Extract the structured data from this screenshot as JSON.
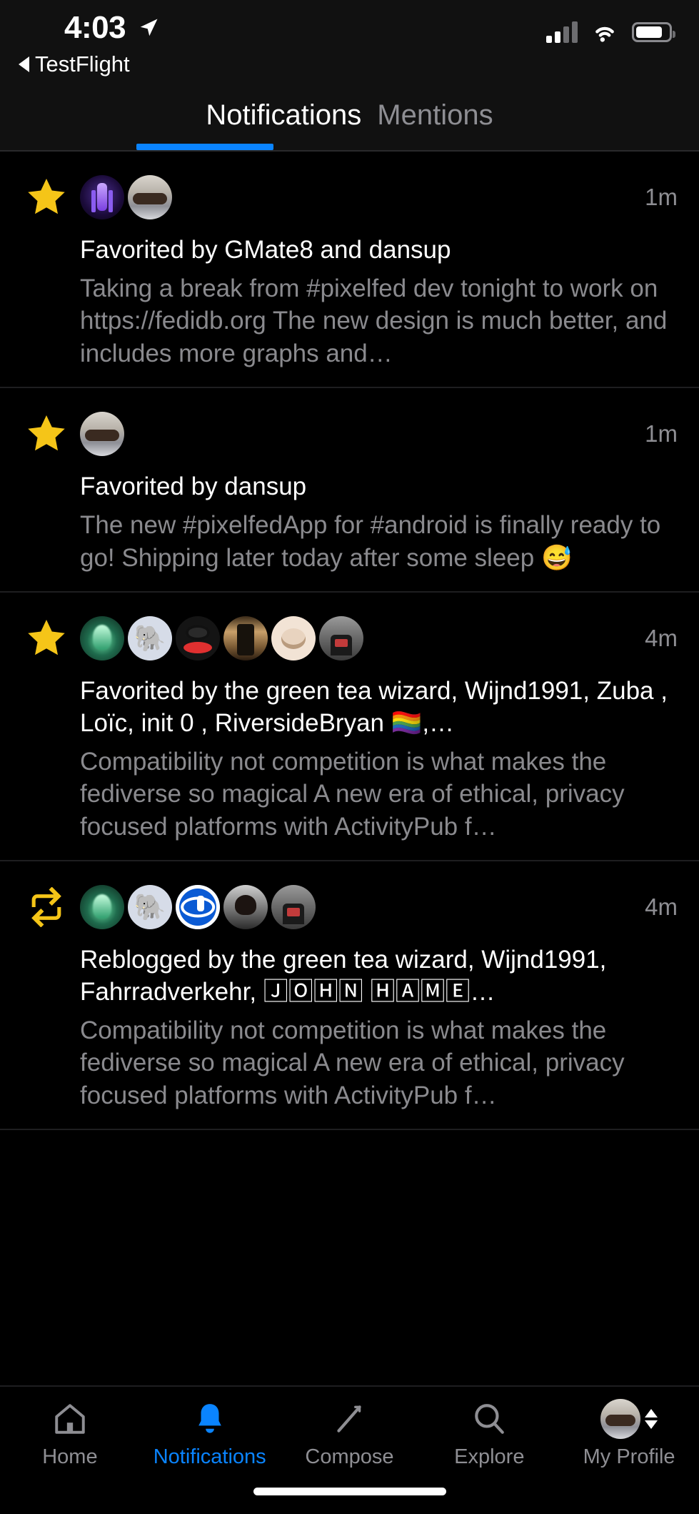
{
  "status_bar": {
    "time": "4:03",
    "back_label": "TestFlight",
    "location_icon": "location-arrow-icon",
    "signal_icon": "cellular-signal-icon",
    "wifi_icon": "wifi-icon",
    "battery_icon": "battery-icon"
  },
  "top_tabs": {
    "items": [
      {
        "label": "Notifications",
        "active": true
      },
      {
        "label": "Mentions",
        "active": false
      }
    ],
    "indicator_color": "#0a84ff"
  },
  "colors": {
    "accent": "#0a84ff",
    "star": "#f5c518",
    "reblog": "#f5c518",
    "title_text": "#ffffff",
    "body_text": "#8a8a8e",
    "timestamp_text": "#8e8e93",
    "background": "#000000",
    "header_background": "#111111",
    "divider": "#1e1e20"
  },
  "notifications": [
    {
      "type_icon": "star-icon",
      "type": "favorite",
      "avatars": [
        "av-gmate8",
        "av-dansup"
      ],
      "title": "Favorited by GMate8 and dansup",
      "body": "Taking a break from #pixelfed dev tonight to work on https://fedidb.org The new design is much better, and includes more graphs and…",
      "timestamp": "1m"
    },
    {
      "type_icon": "star-icon",
      "type": "favorite",
      "avatars": [
        "av-dansup"
      ],
      "title": "Favorited by dansup",
      "body": "The new #pixelfedApp for #android is finally ready to go! Shipping later today after some sleep 😅",
      "timestamp": "1m"
    },
    {
      "type_icon": "star-icon",
      "type": "favorite",
      "avatars": [
        "av-wizard",
        "av-mastodon",
        "av-mask",
        "av-door",
        "av-memoji",
        "av-bryan"
      ],
      "title": "Favorited by the green tea wizard, Wijnd1991, Zuba      , Loïc, init 0   , RiversideBryan 🏳️‍🌈,…",
      "body": "Compatibility not competition is what makes the fediverse so magical A new era of ethical, privacy focused platforms with ActivityPub f…",
      "timestamp": "4m"
    },
    {
      "type_icon": "reblog-icon",
      "type": "reblog",
      "avatars": [
        "av-wizard",
        "av-mastodon",
        "av-bike",
        "av-guy",
        "av-bryan"
      ],
      "title": "Reblogged by the green tea wizard, Wijnd1991, Fahrradverkehr, 🄹🄾🄷🄽 🄷🄰🄼🄴…",
      "body": "Compatibility not competition is what makes the fediverse so magical A new era of ethical, privacy focused platforms with ActivityPub f…",
      "timestamp": "4m"
    }
  ],
  "bottom_tabs": [
    {
      "label": "Home",
      "icon": "home-icon",
      "active": false
    },
    {
      "label": "Notifications",
      "icon": "bell-icon",
      "active": true
    },
    {
      "label": "Compose",
      "icon": "pencil-icon",
      "active": false
    },
    {
      "label": "Explore",
      "icon": "search-icon",
      "active": false
    },
    {
      "label": "My Profile",
      "icon": "avatar-icon",
      "active": false
    }
  ]
}
